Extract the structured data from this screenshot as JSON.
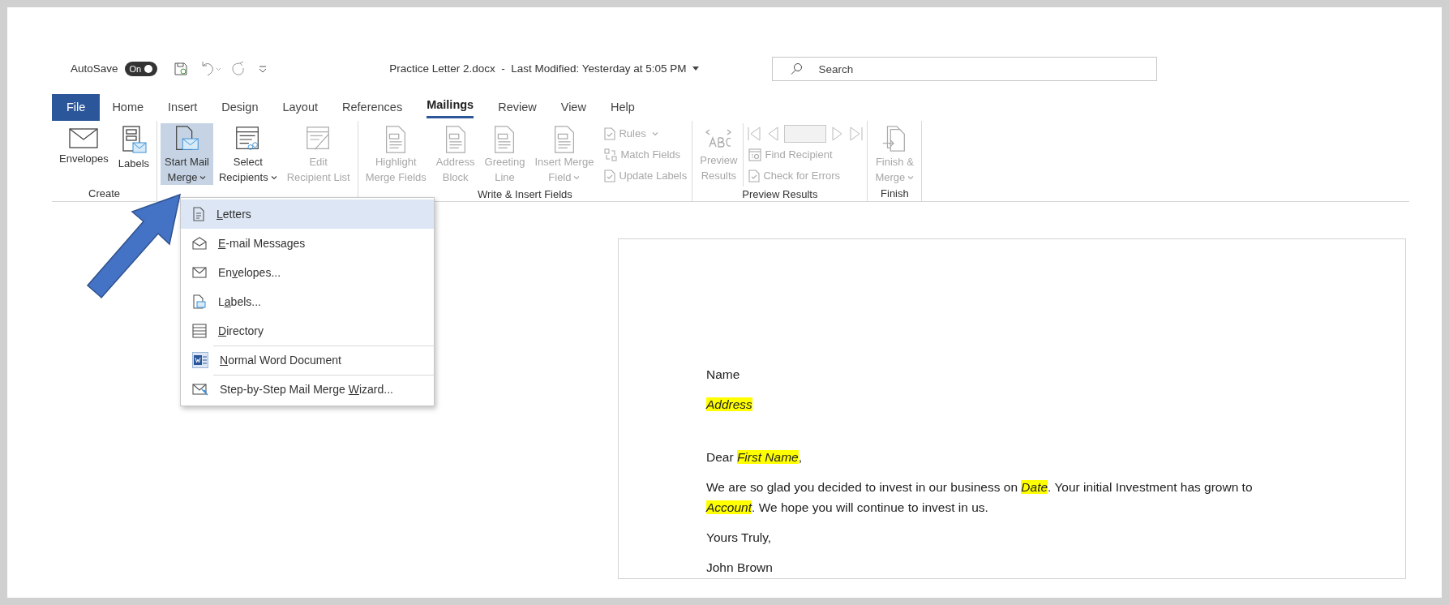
{
  "title_bar": {
    "autosave_label": "AutoSave",
    "autosave_toggle": {
      "label": "On",
      "on": true
    },
    "document_title": "Practice Letter 2.docx  -  Last Modified: Yesterday at 5:05 PM",
    "search": {
      "placeholder": "Search"
    }
  },
  "tabs": [
    {
      "label": "File",
      "kind": "file",
      "selected": false
    },
    {
      "label": "Home",
      "kind": "tab",
      "selected": false
    },
    {
      "label": "Insert",
      "kind": "tab",
      "selected": false
    },
    {
      "label": "Design",
      "kind": "tab",
      "selected": false
    },
    {
      "label": "Layout",
      "kind": "tab",
      "selected": false
    },
    {
      "label": "References",
      "kind": "tab",
      "selected": false
    },
    {
      "label": "Mailings",
      "kind": "tab",
      "selected": true
    },
    {
      "label": "Review",
      "kind": "tab",
      "selected": false
    },
    {
      "label": "View",
      "kind": "tab",
      "selected": false
    },
    {
      "label": "Help",
      "kind": "tab",
      "selected": false
    }
  ],
  "ribbon_groups": [
    {
      "label": "Create",
      "record_navigator": false,
      "buttons": [
        {
          "kind": "large",
          "label_lines": [
            "Envelopes"
          ],
          "dropdown": false,
          "disabled": false,
          "pressed": false
        },
        {
          "kind": "large",
          "label_lines": [
            "Labels"
          ],
          "dropdown": false,
          "disabled": false,
          "pressed": false
        }
      ]
    },
    {
      "record_navigator": false,
      "buttons": [
        {
          "kind": "large",
          "label_lines": [
            "Start Mail",
            "Merge"
          ],
          "dropdown": true,
          "disabled": false,
          "pressed": true
        },
        {
          "kind": "large",
          "label_lines": [
            "Select",
            "Recipients"
          ],
          "dropdown": true,
          "disabled": false,
          "pressed": false
        },
        {
          "kind": "large",
          "label_lines": [
            "Edit",
            "Recipient List"
          ],
          "dropdown": false,
          "disabled": true,
          "pressed": false
        }
      ]
    },
    {
      "label": "Write & Insert Fields",
      "record_navigator": false,
      "buttons": [
        {
          "kind": "large",
          "label_lines": [
            "Highlight",
            "Merge Fields"
          ],
          "dropdown": false,
          "disabled": true,
          "pressed": false
        },
        {
          "kind": "large",
          "label_lines": [
            "Address",
            "Block"
          ],
          "dropdown": false,
          "disabled": true,
          "pressed": false
        },
        {
          "kind": "large",
          "label_lines": [
            "Greeting",
            "Line"
          ],
          "dropdown": false,
          "disabled": true,
          "pressed": false
        },
        {
          "kind": "large",
          "label_lines": [
            "Insert Merge",
            "Field"
          ],
          "dropdown": true,
          "disabled": true,
          "pressed": false
        },
        {
          "kind": "small",
          "label_lines": [
            "Rules"
          ],
          "dropdown": true,
          "disabled": true,
          "pressed": false
        },
        {
          "kind": "small",
          "label_lines": [
            "Match Fields"
          ],
          "dropdown": false,
          "disabled": true,
          "pressed": false
        },
        {
          "kind": "small",
          "label_lines": [
            "Update Labels"
          ],
          "dropdown": false,
          "disabled": true,
          "pressed": false
        }
      ]
    },
    {
      "label": "Preview Results",
      "record_navigator": true,
      "buttons": [
        {
          "kind": "large",
          "label_lines": [
            "Preview",
            "Results"
          ],
          "dropdown": false,
          "disabled": true,
          "pressed": false
        },
        {
          "kind": "small",
          "label_lines": [
            "Find Recipient"
          ],
          "dropdown": false,
          "disabled": true,
          "pressed": false
        },
        {
          "kind": "small",
          "label_lines": [
            "Check for Errors"
          ],
          "dropdown": false,
          "disabled": true,
          "pressed": false
        }
      ]
    },
    {
      "label": "Finish",
      "record_navigator": false,
      "buttons": [
        {
          "kind": "large",
          "label_lines": [
            "Finish &",
            "Merge"
          ],
          "dropdown": true,
          "disabled": true,
          "pressed": false
        }
      ]
    }
  ],
  "menu": [
    {
      "key": "L",
      "after": "etters",
      "selected": true,
      "separator_before": false
    },
    {
      "key": "E",
      "after": "-mail Messages",
      "selected": false,
      "separator_before": false
    },
    {
      "before": "En",
      "key": "v",
      "after": "elopes...",
      "selected": false,
      "separator_before": false
    },
    {
      "before": "L",
      "key": "a",
      "after": "bels...",
      "selected": false,
      "separator_before": false
    },
    {
      "key": "D",
      "after": "irectory",
      "selected": false,
      "separator_before": false
    },
    {
      "key": "N",
      "after": "ormal Word Document",
      "selected": false,
      "separator_before": true
    },
    {
      "before": "Step-by-Step Mail Merge ",
      "key": "W",
      "after": "izard...",
      "selected": false,
      "separator_before": true
    }
  ],
  "letter": [
    {
      "space_before": false,
      "segments": [
        {
          "text": "Name",
          "field": false
        }
      ]
    },
    {
      "space_before": false,
      "segments": [
        {
          "text": "Address",
          "field": true
        }
      ]
    },
    {
      "space_before": true,
      "segments": [
        {
          "text": "Dear ",
          "field": false
        },
        {
          "text": "First Name",
          "field": true
        },
        {
          "text": ",",
          "field": false
        }
      ]
    },
    {
      "space_before": false,
      "segments": [
        {
          "text": "We are so glad you decided to invest in our business on ",
          "field": false
        },
        {
          "text": "Date",
          "field": true
        },
        {
          "text": ". Your initial Investment has grown to ",
          "field": false
        },
        {
          "text": "Account",
          "field": true
        },
        {
          "text": ".  We hope you will continue to invest in us.",
          "field": false
        }
      ]
    },
    {
      "space_before": false,
      "segments": [
        {
          "text": "Yours Truly,",
          "field": false
        }
      ]
    },
    {
      "space_before": false,
      "segments": [
        {
          "text": "John Brown",
          "field": false
        }
      ]
    }
  ]
}
